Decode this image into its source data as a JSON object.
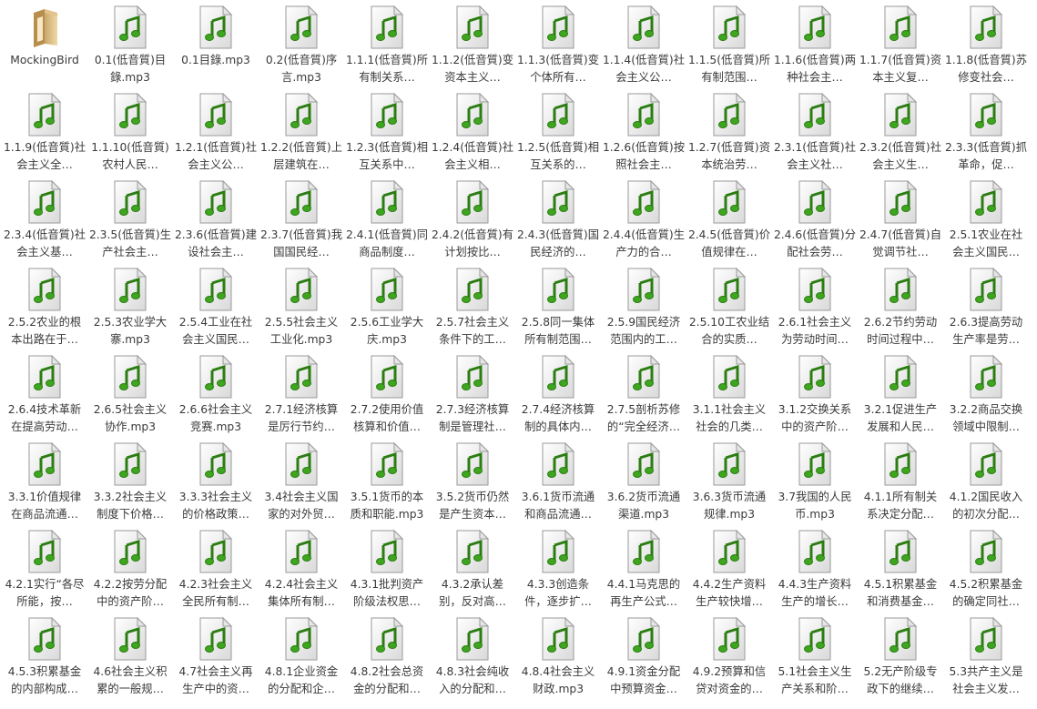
{
  "folder": {
    "name": "MockingBird",
    "icon": "folder-icon"
  },
  "files": [
    {
      "name": "0.1(低音質)目錄.mp3"
    },
    {
      "name": "0.1目錄.mp3"
    },
    {
      "name": "0.2(低音質)序言.mp3"
    },
    {
      "name": "1.1.1(低音質)所有制关系…"
    },
    {
      "name": "1.1.2(低音質)变资本主义…"
    },
    {
      "name": "1.1.3(低音質)变个体所有…"
    },
    {
      "name": "1.1.4(低音質)社会主义公…"
    },
    {
      "name": "1.1.5(低音質)所有制范围…"
    },
    {
      "name": "1.1.6(低音質)两种社会主…"
    },
    {
      "name": "1.1.7(低音質)资本主义复…"
    },
    {
      "name": "1.1.8(低音質)苏修变社会…"
    },
    {
      "name": "1.1.9(低音質)社会主义全…"
    },
    {
      "name": "1.1.10(低音質)农村人民…"
    },
    {
      "name": "1.2.1(低音質)社会主义公…"
    },
    {
      "name": "1.2.2(低音質)上层建筑在…"
    },
    {
      "name": "1.2.3(低音質)相互关系中…"
    },
    {
      "name": "1.2.4(低音質)社会主义相…"
    },
    {
      "name": "1.2.5(低音質)相互关系的…"
    },
    {
      "name": "1.2.6(低音質)按照社会主…"
    },
    {
      "name": "1.2.7(低音質)资本统治劳…"
    },
    {
      "name": "2.3.1(低音質)社会主义社…"
    },
    {
      "name": "2.3.2(低音質)社会主义生…"
    },
    {
      "name": "2.3.3(低音質)抓革命，促…"
    },
    {
      "name": "2.3.4(低音質)社会主义基…"
    },
    {
      "name": "2.3.5(低音質)生产社会主…"
    },
    {
      "name": "2.3.6(低音質)建设社会主…"
    },
    {
      "name": "2.3.7(低音質)我国国民经…"
    },
    {
      "name": "2.4.1(低音質)同商品制度…"
    },
    {
      "name": "2.4.2(低音質)有计划按比…"
    },
    {
      "name": "2.4.3(低音質)国民经济的…"
    },
    {
      "name": "2.4.4(低音質)生产力的合…"
    },
    {
      "name": "2.4.5(低音質)价值规律在…"
    },
    {
      "name": "2.4.6(低音質)分配社会劳…"
    },
    {
      "name": "2.4.7(低音質)自觉调节社…"
    },
    {
      "name": "2.5.1农业在社会主义国民…"
    },
    {
      "name": "2.5.2农业的根本出路在于…"
    },
    {
      "name": "2.5.3农业学大寨.mp3"
    },
    {
      "name": "2.5.4工业在社会主义国民…"
    },
    {
      "name": "2.5.5社会主义工业化.mp3"
    },
    {
      "name": "2.5.6工业学大庆.mp3"
    },
    {
      "name": "2.5.7社会主义条件下的工…"
    },
    {
      "name": "2.5.8同一集体所有制范围…"
    },
    {
      "name": "2.5.9国民经济范围内的工…"
    },
    {
      "name": "2.5.10工农业结合的实质…"
    },
    {
      "name": "2.6.1社会主义为劳动时间…"
    },
    {
      "name": "2.6.2节约劳动时间过程中…"
    },
    {
      "name": "2.6.3提高劳动生产率是劳…"
    },
    {
      "name": "2.6.4技术革新在提高劳动…"
    },
    {
      "name": "2.6.5社会主义协作.mp3"
    },
    {
      "name": "2.6.6社会主义竞赛.mp3"
    },
    {
      "name": "2.7.1经济核算是厉行节约…"
    },
    {
      "name": "2.7.2使用价值核算和价值…"
    },
    {
      "name": "2.7.3经济核算制是管理社…"
    },
    {
      "name": "2.7.4经济核算制的具体内…"
    },
    {
      "name": "2.7.5剖析苏修的“完全经济…"
    },
    {
      "name": "3.1.1社会主义社会的几类…"
    },
    {
      "name": "3.1.2交换关系中的资产阶…"
    },
    {
      "name": "3.2.1促进生产发展和人民…"
    },
    {
      "name": "3.2.2商品交换领域中限制…"
    },
    {
      "name": "3.3.1价值规律在商品流通…"
    },
    {
      "name": "3.3.2社会主义制度下价格…"
    },
    {
      "name": "3.3.3社会主义的价格政策…"
    },
    {
      "name": "3.4社会主义国家的对外贸…"
    },
    {
      "name": "3.5.1货币的本质和职能.mp3"
    },
    {
      "name": "3.5.2货币仍然是产生资本…"
    },
    {
      "name": "3.6.1货币流通和商品流通…"
    },
    {
      "name": "3.6.2货币流通渠道.mp3"
    },
    {
      "name": "3.6.3货币流通规律.mp3"
    },
    {
      "name": "3.7我国的人民币.mp3"
    },
    {
      "name": "4.1.1所有制关系决定分配…"
    },
    {
      "name": "4.1.2国民收入的初次分配…"
    },
    {
      "name": "4.2.1实行“各尽所能，按…"
    },
    {
      "name": "4.2.2按劳分配中的资产阶…"
    },
    {
      "name": "4.2.3社会主义全民所有制…"
    },
    {
      "name": "4.2.4社会主义集体所有制…"
    },
    {
      "name": "4.3.1批判资产阶级法权思…"
    },
    {
      "name": "4.3.2承认差别，反对高…"
    },
    {
      "name": "4.3.3创造条件，逐步扩…"
    },
    {
      "name": "4.4.1马克思的再生产公式…"
    },
    {
      "name": "4.4.2生产资料生产较快增…"
    },
    {
      "name": "4.4.3生产资料生产的增长…"
    },
    {
      "name": "4.5.1积累基金和消费基金…"
    },
    {
      "name": "4.5.2积累基金的确定同社…"
    },
    {
      "name": "4.5.3积累基金的内部构成…"
    },
    {
      "name": "4.6社会主义积累的一般规…"
    },
    {
      "name": "4.7社会主义再生产中的资…"
    },
    {
      "name": "4.8.1企业资金的分配和企…"
    },
    {
      "name": "4.8.2社会总资金的分配和…"
    },
    {
      "name": "4.8.3社会纯收入的分配和…"
    },
    {
      "name": "4.8.4社会主义财政.mp3"
    },
    {
      "name": "4.9.1资金分配中预算资金…"
    },
    {
      "name": "4.9.2预算和信贷对资金的…"
    },
    {
      "name": "5.1社会主义生产关系和阶…"
    },
    {
      "name": "5.2无产阶级专政下的继续…"
    },
    {
      "name": "5.3共产主义是社会主义发…"
    }
  ],
  "file_icon": "audio-file-icon",
  "colors": {
    "note": "#3ea51f",
    "note_dark": "#2b7d12",
    "page": "#ffffff"
  }
}
